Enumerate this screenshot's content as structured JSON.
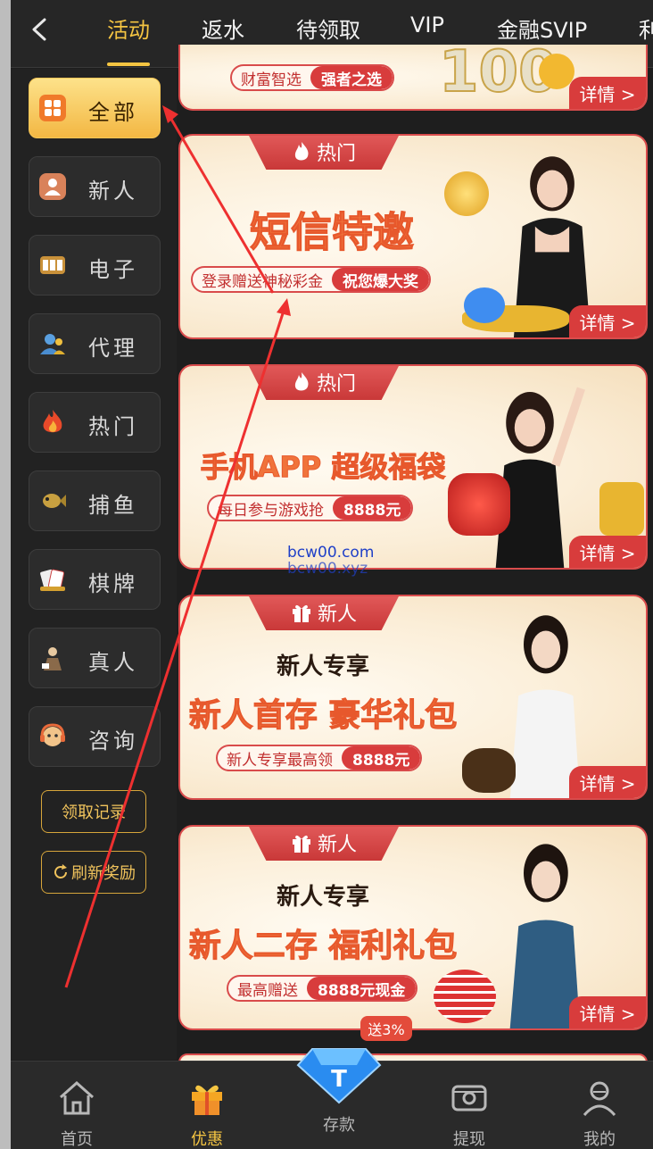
{
  "nav": {
    "tabs": [
      "活动",
      "返水",
      "待领取",
      "VIP",
      "金融SVIP",
      "利"
    ],
    "active_tab": "活动"
  },
  "sidebar": {
    "items": [
      {
        "label": "全部",
        "icon": "grid-icon"
      },
      {
        "label": "新人",
        "icon": "person-icon"
      },
      {
        "label": "电子",
        "icon": "slot-machine-icon"
      },
      {
        "label": "代理",
        "icon": "agent-icon"
      },
      {
        "label": "热门",
        "icon": "fire-icon"
      },
      {
        "label": "捕鱼",
        "icon": "fish-icon"
      },
      {
        "label": "棋牌",
        "icon": "cards-icon"
      },
      {
        "label": "真人",
        "icon": "dealer-icon"
      },
      {
        "label": "咨询",
        "icon": "support-icon"
      }
    ],
    "claim_record": "领取记录",
    "refresh_reward": "刷新奖励"
  },
  "banners": [
    {
      "tag": "",
      "pill_a": "财富智选",
      "pill_b": "强者之选",
      "detail": "详情 >",
      "big": "100"
    },
    {
      "tag": "热门",
      "title": "短信特邀",
      "pill_a": "登录赠送神秘彩金",
      "pill_b": "祝您爆大奖",
      "detail": "详情 >"
    },
    {
      "tag": "热门",
      "title": "手机APP 超级福袋",
      "pill_a": "每日参与游戏抢",
      "pill_b": "8888元",
      "detail": "详情 >"
    },
    {
      "tag": "新人",
      "subtitle": "新人专享",
      "title": "新人首存 豪华礼包",
      "pill_a": "新人专享最高领",
      "pill_b": "8888元",
      "detail": "详情 >"
    },
    {
      "tag": "新人",
      "subtitle": "新人专享",
      "title": "新人二存 福利礼包",
      "pill_a": "最高赠送",
      "pill_b": "8888元现金",
      "detail": "详情 >"
    }
  ],
  "watermark": [
    "bcw00.com",
    "bcw00.xyz"
  ],
  "bottom_nav": {
    "items": [
      {
        "label": "首页",
        "icon": "home-icon"
      },
      {
        "label": "优惠",
        "icon": "gift-icon"
      },
      {
        "label": "存款",
        "icon": "diamond-icon"
      },
      {
        "label": "提现",
        "icon": "withdraw-icon"
      },
      {
        "label": "我的",
        "icon": "profile-icon"
      }
    ],
    "active": "优惠",
    "deposit_badge": "送3%"
  },
  "colors": {
    "accent": "#f5c542",
    "banner_red": "#d83c3c",
    "background": "#1e1e1e"
  }
}
